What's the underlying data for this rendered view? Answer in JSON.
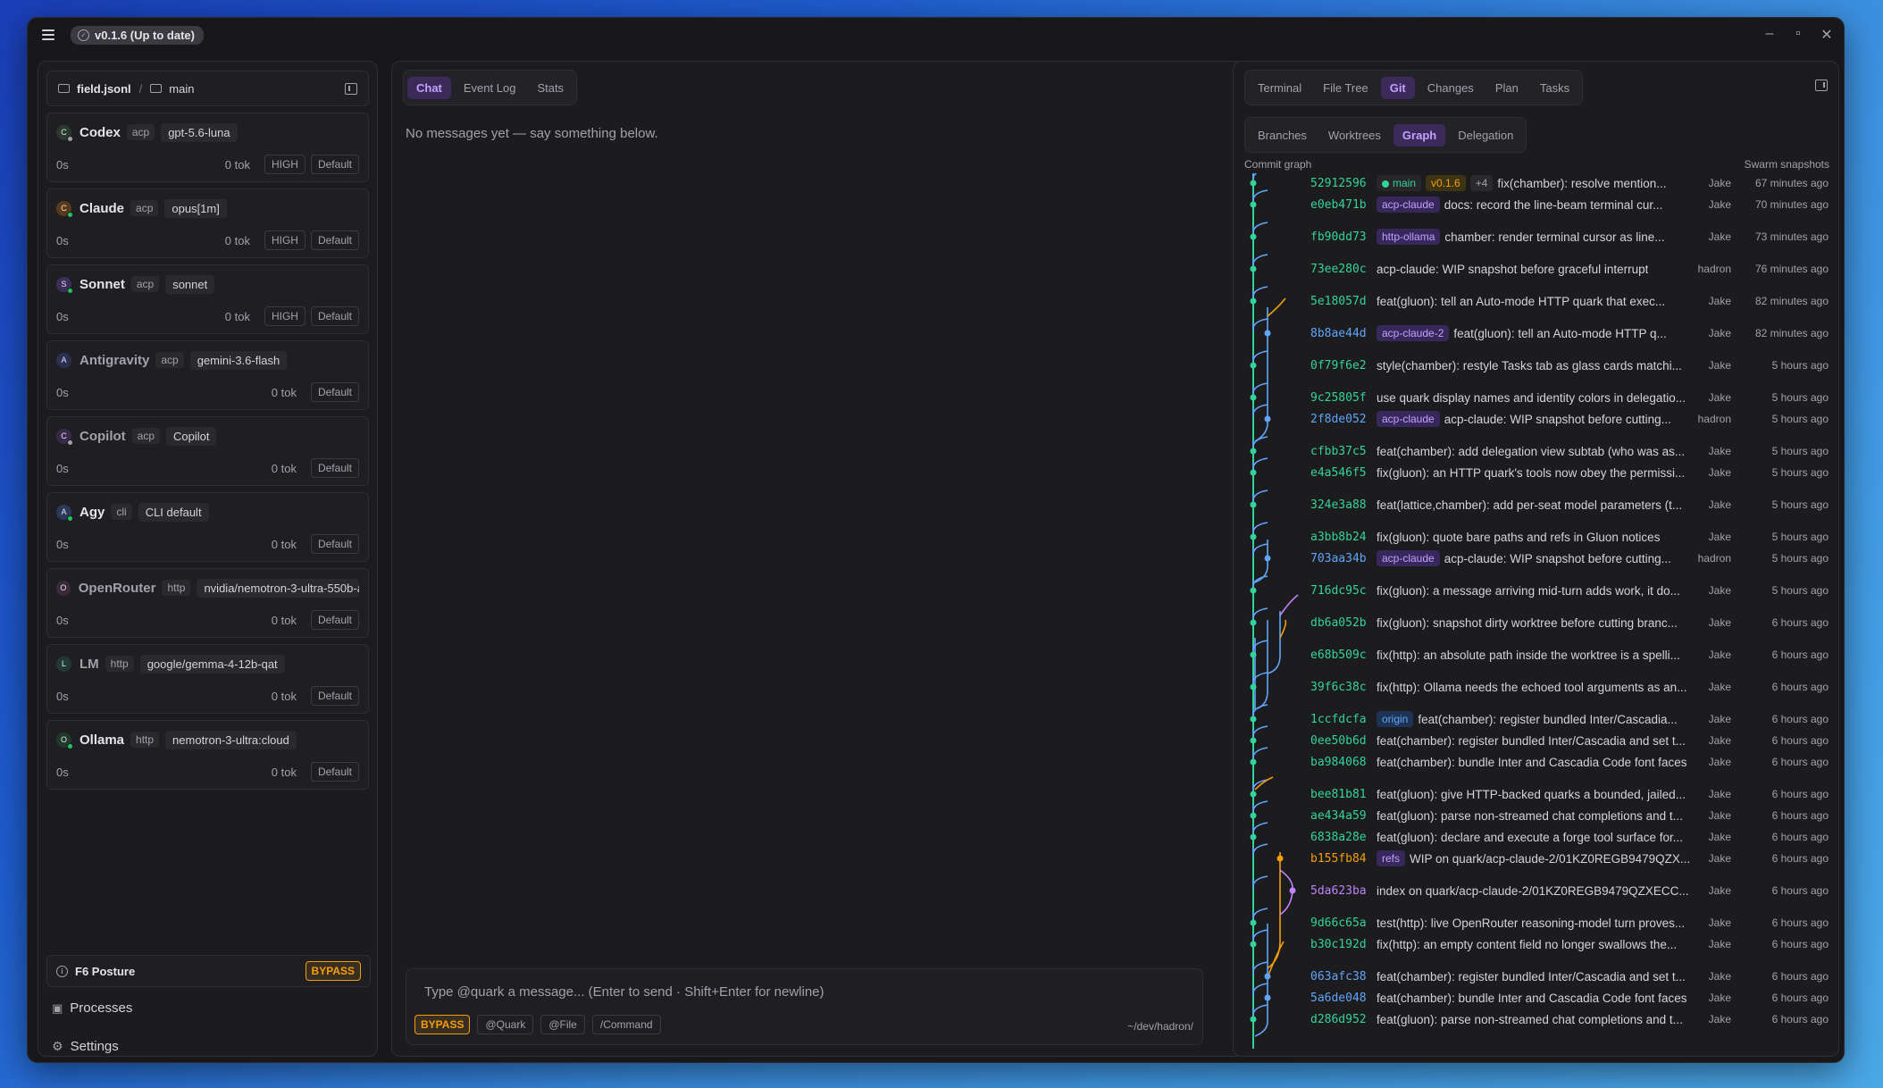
{
  "titlebar": {
    "version": "v0.1.6 (Up to date)"
  },
  "left": {
    "crumb": {
      "file": "field.jsonl",
      "sep": "/",
      "branch": "main"
    },
    "agents": [
      {
        "initial": "C",
        "name": "Codex",
        "kind": "acp",
        "model": "gpt-5.6-luna",
        "time": "0s",
        "tok": "0 tok",
        "level": "HIGH",
        "mode": "Default",
        "color": "#2b3a30",
        "status": "#a1a1aa"
      },
      {
        "initial": "C",
        "name": "Claude",
        "kind": "acp",
        "model": "opus[1m]",
        "time": "0s",
        "tok": "0 tok",
        "level": "HIGH",
        "mode": "Default",
        "color": "#5a3a1a",
        "status": "#22c55e"
      },
      {
        "initial": "S",
        "name": "Sonnet",
        "kind": "acp",
        "model": "sonnet",
        "time": "0s",
        "tok": "0 tok",
        "level": "HIGH",
        "mode": "Default",
        "color": "#3d2d5a",
        "status": "#22c55e"
      },
      {
        "initial": "A",
        "name": "Antigravity",
        "kind": "acp",
        "model": "gemini-3.6-flash",
        "time": "0s",
        "tok": "0 tok",
        "level": "",
        "mode": "Default",
        "color": "#2a3050",
        "status": "",
        "dim": true
      },
      {
        "initial": "C",
        "name": "Copilot",
        "kind": "acp",
        "model": "Copilot",
        "time": "0s",
        "tok": "0 tok",
        "level": "",
        "mode": "Default",
        "color": "#3a2a4a",
        "status": "#a1a1aa",
        "dim": true
      },
      {
        "initial": "A",
        "name": "Agy",
        "kind": "cli",
        "model": "CLI default",
        "time": "0s",
        "tok": "0 tok",
        "level": "",
        "mode": "Default",
        "color": "#2a3a5a",
        "status": "#22c55e"
      },
      {
        "initial": "O",
        "name": "OpenRouter",
        "kind": "http",
        "model": "nvidia/nemotron-3-ultra-550b-a",
        "time": "0s",
        "tok": "0 tok",
        "level": "",
        "mode": "Default",
        "color": "#3a2a3a",
        "status": "",
        "dim": true
      },
      {
        "initial": "L",
        "name": "LM",
        "kind": "http",
        "model": "google/gemma-4-12b-qat",
        "time": "0s",
        "tok": "0 tok",
        "level": "",
        "mode": "Default",
        "color": "#1f3a35",
        "status": "",
        "dim": true
      },
      {
        "initial": "O",
        "name": "Ollama",
        "kind": "http",
        "model": "nemotron-3-ultra:cloud",
        "time": "0s",
        "tok": "0 tok",
        "level": "",
        "mode": "Default",
        "color": "#1f3a2a",
        "status": "#22c55e"
      }
    ],
    "posture": {
      "label": "F6 Posture",
      "badge": "BYPASS"
    },
    "processes": "Processes",
    "settings": "Settings"
  },
  "center": {
    "tabs": [
      "Chat",
      "Event Log",
      "Stats"
    ],
    "empty": "No messages yet — say something below.",
    "composer": {
      "placeholder": "Type @quark a message...  (Enter to send · Shift+Enter for newline)",
      "bypass": "BYPASS",
      "quark": "@Quark",
      "file": "@File",
      "command": "/Command",
      "path": "~/dev/hadron/"
    }
  },
  "right": {
    "tabs": [
      "Terminal",
      "File Tree",
      "Git",
      "Changes",
      "Plan",
      "Tasks"
    ],
    "subtabs": [
      "Branches",
      "Worktrees",
      "Graph",
      "Delegation"
    ],
    "graph_label": "Commit graph",
    "swarm_label": "Swarm snapshots",
    "commits": [
      {
        "hash": "52912596",
        "refs": [
          {
            "t": "main",
            "c": "main"
          },
          {
            "t": "v0.1.6",
            "c": "ver"
          },
          {
            "t": "+4",
            "c": "plus"
          }
        ],
        "msg": "fix(chamber): resolve mention...",
        "author": "Jake",
        "time": "67 minutes ago"
      },
      {
        "hash": "e0eb471b",
        "refs": [
          {
            "t": "acp-claude",
            "c": "br"
          }
        ],
        "msg": "docs: record the line-beam terminal cur...",
        "author": "Jake",
        "time": "70 minutes ago"
      },
      {
        "hash": "fb90dd73",
        "refs": [
          {
            "t": "http-ollama",
            "c": "br"
          }
        ],
        "msg": "chamber: render terminal cursor as line...",
        "author": "Jake",
        "time": "73 minutes ago"
      },
      {
        "hash": "73ee280c",
        "refs": [],
        "msg": "acp-claude: WIP snapshot before graceful interrupt",
        "author": "hadron",
        "time": "76 minutes ago"
      },
      {
        "hash": "5e18057d",
        "refs": [],
        "msg": "feat(gluon): tell an Auto-mode HTTP quark that exec...",
        "author": "Jake",
        "time": "82 minutes ago"
      },
      {
        "hash": "8b8ae44d",
        "refs": [
          {
            "t": "acp-claude-2",
            "c": "br"
          }
        ],
        "msg": "feat(gluon): tell an Auto-mode HTTP q...",
        "author": "Jake",
        "time": "82 minutes ago",
        "hc": "#60a5fa"
      },
      {
        "hash": "0f79f6e2",
        "refs": [],
        "msg": "style(chamber): restyle Tasks tab as glass cards matchi...",
        "author": "Jake",
        "time": "5 hours ago"
      },
      {
        "hash": "9c25805f",
        "refs": [],
        "msg": "use quark display names and identity colors in delegatio...",
        "author": "Jake",
        "time": "5 hours ago"
      },
      {
        "hash": "2f8de052",
        "refs": [
          {
            "t": "acp-claude",
            "c": "br"
          }
        ],
        "msg": "acp-claude: WIP snapshot before cutting...",
        "author": "hadron",
        "time": "5 hours ago",
        "hc": "#60a5fa"
      },
      {
        "hash": "cfbb37c5",
        "refs": [],
        "msg": "feat(chamber): add delegation view subtab (who was as...",
        "author": "Jake",
        "time": "5 hours ago"
      },
      {
        "hash": "e4a546f5",
        "refs": [],
        "msg": "fix(gluon): an HTTP quark's tools now obey the permissi...",
        "author": "Jake",
        "time": "5 hours ago"
      },
      {
        "hash": "324e3a88",
        "refs": [],
        "msg": "feat(lattice,chamber): add per-seat model parameters (t...",
        "author": "Jake",
        "time": "5 hours ago"
      },
      {
        "hash": "a3bb8b24",
        "refs": [],
        "msg": "fix(gluon): quote bare paths and refs in Gluon notices",
        "author": "Jake",
        "time": "5 hours ago"
      },
      {
        "hash": "703aa34b",
        "refs": [
          {
            "t": "acp-claude",
            "c": "br"
          }
        ],
        "msg": "acp-claude: WIP snapshot before cutting...",
        "author": "hadron",
        "time": "5 hours ago",
        "hc": "#60a5fa"
      },
      {
        "hash": "716dc95c",
        "refs": [],
        "msg": "fix(gluon): a message arriving mid-turn adds work, it do...",
        "author": "Jake",
        "time": "5 hours ago"
      },
      {
        "hash": "db6a052b",
        "refs": [],
        "msg": "fix(gluon): snapshot dirty worktree before cutting branc...",
        "author": "Jake",
        "time": "6 hours ago"
      },
      {
        "hash": "e68b509c",
        "refs": [],
        "msg": "fix(http): an absolute path inside the worktree is a spelli...",
        "author": "Jake",
        "time": "6 hours ago"
      },
      {
        "hash": "39f6c38c",
        "refs": [],
        "msg": "fix(http): Ollama needs the echoed tool arguments as an...",
        "author": "Jake",
        "time": "6 hours ago"
      },
      {
        "hash": "1ccfdcfa",
        "refs": [
          {
            "t": "origin",
            "c": "org"
          }
        ],
        "msg": "feat(chamber): register bundled Inter/Cascadia...",
        "author": "Jake",
        "time": "6 hours ago"
      },
      {
        "hash": "0ee50b6d",
        "refs": [],
        "msg": "feat(chamber): register bundled Inter/Cascadia and set t...",
        "author": "Jake",
        "time": "6 hours ago"
      },
      {
        "hash": "ba984068",
        "refs": [],
        "msg": "feat(chamber): bundle Inter and Cascadia Code font faces",
        "author": "Jake",
        "time": "6 hours ago"
      },
      {
        "hash": "bee81b81",
        "refs": [],
        "msg": "feat(gluon): give HTTP-backed quarks a bounded, jailed...",
        "author": "Jake",
        "time": "6 hours ago"
      },
      {
        "hash": "ae434a59",
        "refs": [],
        "msg": "feat(gluon): parse non-streamed chat completions and t...",
        "author": "Jake",
        "time": "6 hours ago"
      },
      {
        "hash": "6838a28e",
        "refs": [],
        "msg": "feat(gluon): declare and execute a forge tool surface for...",
        "author": "Jake",
        "time": "6 hours ago"
      },
      {
        "hash": "b155fb84",
        "refs": [
          {
            "t": "refs",
            "c": "br"
          }
        ],
        "msg": "WIP on quark/acp-claude-2/01KZ0REGB9479QZX...",
        "author": "Jake",
        "time": "6 hours ago",
        "hc": "#f59e0b"
      },
      {
        "hash": "5da623ba",
        "refs": [],
        "msg": "index on quark/acp-claude-2/01KZ0REGB9479QZXECC...",
        "author": "Jake",
        "time": "6 hours ago",
        "hc": "#c084fc"
      },
      {
        "hash": "9d66c65a",
        "refs": [],
        "msg": "test(http): live OpenRouter reasoning-model turn proves...",
        "author": "Jake",
        "time": "6 hours ago"
      },
      {
        "hash": "b30c192d",
        "refs": [],
        "msg": "fix(http): an empty content field no longer swallows the...",
        "author": "Jake",
        "time": "6 hours ago"
      },
      {
        "hash": "063afc38",
        "refs": [],
        "msg": "feat(chamber): register bundled Inter/Cascadia and set t...",
        "author": "Jake",
        "time": "6 hours ago",
        "hc": "#60a5fa"
      },
      {
        "hash": "5a6de048",
        "refs": [],
        "msg": "feat(chamber): bundle Inter and Cascadia Code font faces",
        "author": "Jake",
        "time": "6 hours ago",
        "hc": "#60a5fa"
      },
      {
        "hash": "d286d952",
        "refs": [],
        "msg": "feat(gluon): parse non-streamed chat completions and t...",
        "author": "Jake",
        "time": "6 hours ago"
      }
    ]
  }
}
